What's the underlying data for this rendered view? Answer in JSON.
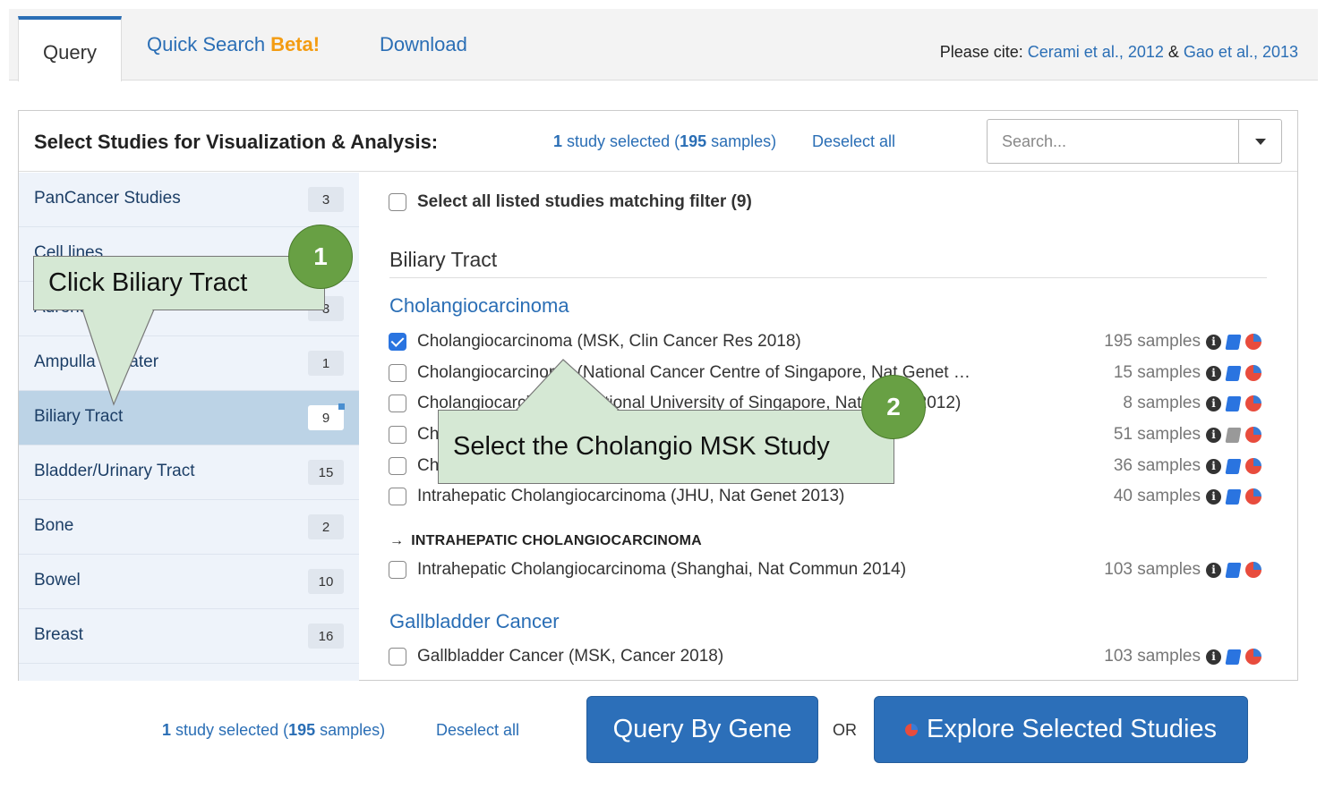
{
  "tabs": {
    "query": "Query",
    "quick_search": "Quick Search",
    "beta": "Beta!",
    "download": "Download"
  },
  "cite": {
    "prefix": "Please cite:",
    "ref1": "Cerami et al., 2012",
    "amp": "&",
    "ref2": "Gao et al., 2013"
  },
  "panel": {
    "title": "Select Studies for Visualization & Analysis:",
    "selected_count": "1",
    "selected_mid": "study selected (",
    "selected_samples": "195",
    "selected_end": "samples)",
    "deselect": "Deselect all",
    "search_placeholder": "Search..."
  },
  "sidebar": {
    "items": [
      {
        "label": "PanCancer Studies",
        "count": "3"
      },
      {
        "label": "Cell lines",
        "count": ""
      },
      {
        "label": "Adrenal",
        "count": "3"
      },
      {
        "label": "Ampulla of Vater",
        "count": "1"
      },
      {
        "label": "Biliary Tract",
        "count": "9"
      },
      {
        "label": "Bladder/Urinary Tract",
        "count": "15"
      },
      {
        "label": "Bone",
        "count": "2"
      },
      {
        "label": "Bowel",
        "count": "10"
      },
      {
        "label": "Breast",
        "count": "16"
      }
    ]
  },
  "content": {
    "filter_label": "Select all listed studies matching filter (9)",
    "section": "Biliary Tract",
    "subsections": [
      "Cholangiocarcinoma",
      "Gallbladder Cancer"
    ],
    "studies": [
      {
        "name": "Cholangiocarcinoma (MSK, Clin Cancer Res 2018)",
        "samples": "195 samples",
        "checked": true
      },
      {
        "name": "Cholangiocarcinoma (National Cancer Centre of Singapore, Nat Genet …",
        "samples": "15 samples",
        "checked": false
      },
      {
        "name": "Cholangiocarcinoma (National University of Singapore, Nat Genet 2012)",
        "samples": "8 samples",
        "checked": false
      },
      {
        "name": "Ch",
        "samples": "51 samples",
        "checked": false
      },
      {
        "name": "Ch",
        "samples": "36 samples",
        "checked": false
      },
      {
        "name": "Intrahepatic Cholangiocarcinoma (JHU, Nat Genet 2013)",
        "samples": "40 samples",
        "checked": false
      },
      {
        "name": "Intrahepatic Cholangiocarcinoma (Shanghai, Nat Commun 2014)",
        "samples": "103 samples",
        "checked": false
      },
      {
        "name": "Gallbladder Cancer (MSK, Cancer 2018)",
        "samples": "103 samples",
        "checked": false
      }
    ],
    "subtype_arrow": "→",
    "subtype": "INTRAHEPATIC CHOLANGIOCARCINOMA"
  },
  "bottom": {
    "selected_count": "1",
    "selected_mid": "study selected (",
    "selected_samples": "195",
    "selected_end": "samples)",
    "deselect": "Deselect all",
    "query_button": "Query By Gene",
    "or": "OR",
    "explore_button": "Explore Selected Studies"
  },
  "annotations": {
    "callout1": "Click Biliary Tract",
    "badge1": "1",
    "callout2": "Select the Cholangio MSK Study",
    "badge2": "2"
  },
  "colors": {
    "link": "#2a6eb5",
    "primary_button": "#2c6fb9",
    "callout_fill": "#d5e8d4",
    "badge": "#68a044",
    "beta": "#f39c12",
    "active_item": "#bcd3e6"
  },
  "icons": [
    "info-icon",
    "study-book-icon",
    "pie-chart-icon",
    "chevron-down-icon"
  ]
}
